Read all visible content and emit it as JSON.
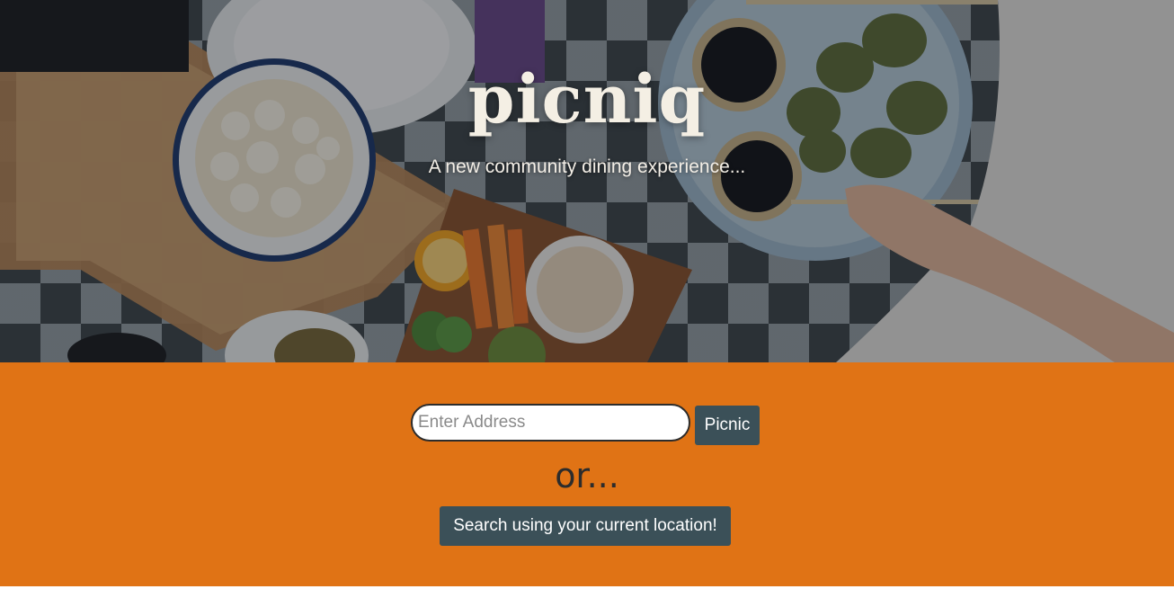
{
  "hero": {
    "title": "picniq",
    "subtitle": "A new community dining experience..."
  },
  "search": {
    "address_placeholder": "Enter Address",
    "address_value": "",
    "picnic_button_label": "Picnic",
    "or_text": "or...",
    "location_button_label": "Search using your current location!"
  },
  "colors": {
    "band_background": "#e07315",
    "button_background": "#3b5058",
    "button_text": "#ffffff",
    "title_text": "#f4efe4"
  }
}
